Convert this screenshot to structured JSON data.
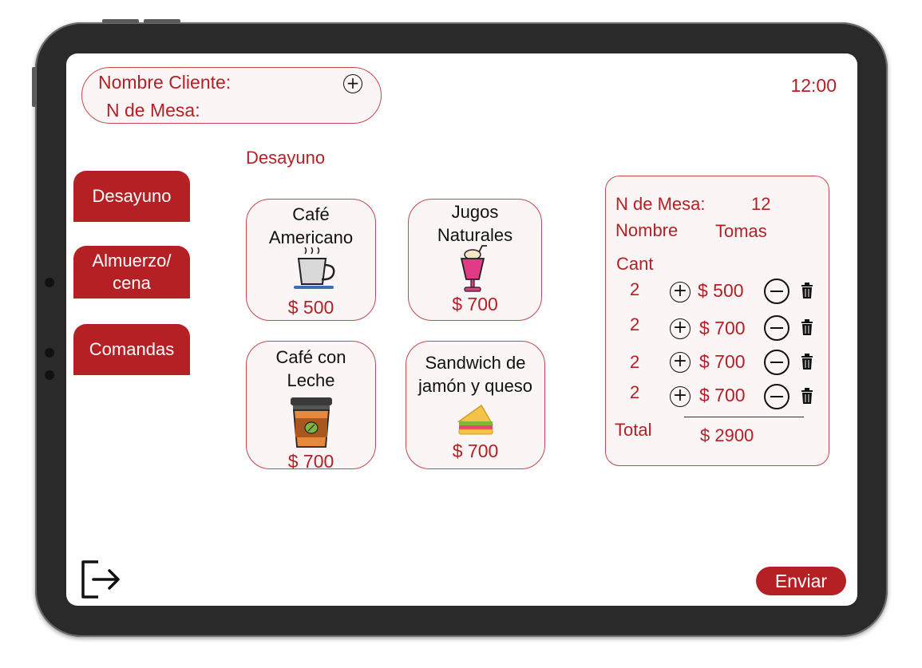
{
  "header": {
    "client_name_label": "Nombre Cliente:",
    "table_label": "N de Mesa:",
    "add_icon": "+",
    "clock": "12:00"
  },
  "section_title": "Desayuno",
  "categories": [
    {
      "label": "Desayuno"
    },
    {
      "label": "Almuerzo/\ncena"
    },
    {
      "label": "Comandas"
    }
  ],
  "products": [
    {
      "name": "Café\nAmericano",
      "price": "$ 500",
      "icon": "coffee-cup-icon"
    },
    {
      "name": "Jugos\nNaturales",
      "price": "$ 700",
      "icon": "milkshake-icon"
    },
    {
      "name": "Café con\nLeche",
      "price": "$ 700",
      "icon": "takeaway-coffee-icon"
    },
    {
      "name": "Sandwich de\njamón y queso",
      "price": "$ 700",
      "icon": "sandwich-icon"
    }
  ],
  "order": {
    "table_label": "N de Mesa:",
    "table_value": "12",
    "name_label": "Nombre",
    "name_value": "Tomas",
    "qty_header": "Cant",
    "plus_icon": "+",
    "rows": [
      {
        "qty": "2",
        "price": "$ 500"
      },
      {
        "qty": "2",
        "price": "$ 700"
      },
      {
        "qty": "2",
        "price": "$ 700"
      },
      {
        "qty": "2",
        "price": "$ 700"
      }
    ],
    "total_label": "Total",
    "total_value": "$ 2900"
  },
  "footer": {
    "send_label": "Enviar",
    "logout_icon": "logout-icon"
  },
  "colors": {
    "accent": "#b52025",
    "panel_bg": "#fbf5f5",
    "border": "#c24a4e"
  }
}
